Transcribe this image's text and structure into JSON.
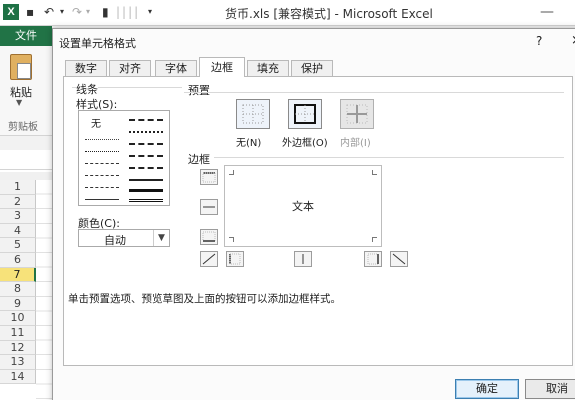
{
  "excel": {
    "title": "货币.xls  [兼容模式] - Microsoft Excel",
    "icon_letter": "X",
    "file_tab": "文件",
    "paste_label": "粘贴",
    "clipboard_group": "剪贴板",
    "row_headers": [
      "1",
      "2",
      "3",
      "4",
      "5",
      "6",
      "7",
      "8",
      "9",
      "10",
      "11",
      "12",
      "13",
      "14"
    ],
    "selected_row": "7",
    "minimize_glyph": "—"
  },
  "dialog": {
    "title": "设置单元格格式",
    "help": "?",
    "close": "×",
    "tabs": [
      "数字",
      "对齐",
      "字体",
      "边框",
      "填充",
      "保护"
    ],
    "active_tab": "边框",
    "line_section": {
      "legend": "线条",
      "style_label": "样式(S):",
      "none_label": "无",
      "color_label": "颜色(C):",
      "color_value": "自动"
    },
    "presets_section": {
      "legend": "预置",
      "items": [
        {
          "label": "无(N)",
          "enabled": true
        },
        {
          "label": "外边框(O)",
          "enabled": true
        },
        {
          "label": "内部(I)",
          "enabled": false
        }
      ]
    },
    "border_section": {
      "legend": "边框",
      "preview_text": "文本"
    },
    "hint": "单击预置选项、预览草图及上面的按钮可以添加边框样式。",
    "buttons": {
      "ok": "确定",
      "cancel": "取消"
    }
  }
}
